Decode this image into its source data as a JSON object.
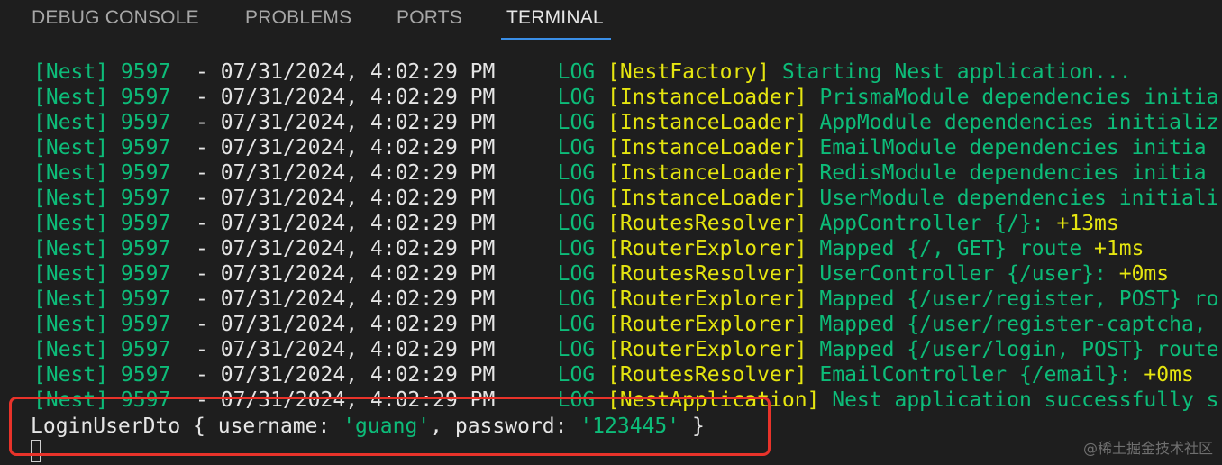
{
  "tabs": [
    {
      "label": "DEBUG CONSOLE"
    },
    {
      "label": "PROBLEMS"
    },
    {
      "label": "PORTS"
    },
    {
      "label": "TERMINAL"
    }
  ],
  "active_tab": "TERMINAL",
  "colors": {
    "background": "#1e1e1e",
    "green": "#0dbc79",
    "yellow": "#e5e510",
    "white": "#e5e5e5",
    "tab_underline": "#3a8ee6",
    "highlight": "#e8332a"
  },
  "log_lines": [
    {
      "prefix": "[Nest] 9597  ",
      "dash": "- ",
      "timestamp": "07/31/2024, 4:02:29 PM",
      "level": "     LOG ",
      "context": "[NestFactory]",
      "message": " Starting Nest application...",
      "timing": ""
    },
    {
      "prefix": "[Nest] 9597  ",
      "dash": "- ",
      "timestamp": "07/31/2024, 4:02:29 PM",
      "level": "     LOG ",
      "context": "[InstanceLoader]",
      "message": " PrismaModule dependencies initia",
      "timing": ""
    },
    {
      "prefix": "[Nest] 9597  ",
      "dash": "- ",
      "timestamp": "07/31/2024, 4:02:29 PM",
      "level": "     LOG ",
      "context": "[InstanceLoader]",
      "message": " AppModule dependencies initializ",
      "timing": ""
    },
    {
      "prefix": "[Nest] 9597  ",
      "dash": "- ",
      "timestamp": "07/31/2024, 4:02:29 PM",
      "level": "     LOG ",
      "context": "[InstanceLoader]",
      "message": " EmailModule dependencies initia",
      "timing": ""
    },
    {
      "prefix": "[Nest] 9597  ",
      "dash": "- ",
      "timestamp": "07/31/2024, 4:02:29 PM",
      "level": "     LOG ",
      "context": "[InstanceLoader]",
      "message": " RedisModule dependencies initia",
      "timing": ""
    },
    {
      "prefix": "[Nest] 9597  ",
      "dash": "- ",
      "timestamp": "07/31/2024, 4:02:29 PM",
      "level": "     LOG ",
      "context": "[InstanceLoader]",
      "message": " UserModule dependencies initiali",
      "timing": ""
    },
    {
      "prefix": "[Nest] 9597  ",
      "dash": "- ",
      "timestamp": "07/31/2024, 4:02:29 PM",
      "level": "     LOG ",
      "context": "[RoutesResolver]",
      "message": " AppController {/}: ",
      "timing": "+13ms"
    },
    {
      "prefix": "[Nest] 9597  ",
      "dash": "- ",
      "timestamp": "07/31/2024, 4:02:29 PM",
      "level": "     LOG ",
      "context": "[RouterExplorer]",
      "message": " Mapped {/, GET} route ",
      "timing": "+1ms"
    },
    {
      "prefix": "[Nest] 9597  ",
      "dash": "- ",
      "timestamp": "07/31/2024, 4:02:29 PM",
      "level": "     LOG ",
      "context": "[RoutesResolver]",
      "message": " UserController {/user}: ",
      "timing": "+0ms"
    },
    {
      "prefix": "[Nest] 9597  ",
      "dash": "- ",
      "timestamp": "07/31/2024, 4:02:29 PM",
      "level": "     LOG ",
      "context": "[RouterExplorer]",
      "message": " Mapped {/user/register, POST} ro",
      "timing": ""
    },
    {
      "prefix": "[Nest] 9597  ",
      "dash": "- ",
      "timestamp": "07/31/2024, 4:02:29 PM",
      "level": "     LOG ",
      "context": "[RouterExplorer]",
      "message": " Mapped {/user/register-captcha, ",
      "timing": ""
    },
    {
      "prefix": "[Nest] 9597  ",
      "dash": "- ",
      "timestamp": "07/31/2024, 4:02:29 PM",
      "level": "     LOG ",
      "context": "[RouterExplorer]",
      "message": " Mapped {/user/login, POST} route",
      "timing": ""
    },
    {
      "prefix": "[Nest] 9597  ",
      "dash": "- ",
      "timestamp": "07/31/2024, 4:02:29 PM",
      "level": "     LOG ",
      "context": "[RoutesResolver]",
      "message": " EmailController {/email}: ",
      "timing": "+0ms"
    },
    {
      "prefix": "[Nest] 9597  ",
      "dash": "- ",
      "timestamp": "07/31/2024, 4:02:29 PM",
      "level": "     LOG ",
      "context": "[NestApplication]",
      "message": " Nest application successfully s",
      "timing": ""
    }
  ],
  "dto_output": {
    "name": "LoginUserDto",
    "open": " { ",
    "key1": "username: ",
    "val1": "'guang'",
    "sep": ", ",
    "key2": "password: ",
    "val2": "'123445'",
    "close": " }"
  },
  "watermark": "@稀土掘金技术社区"
}
